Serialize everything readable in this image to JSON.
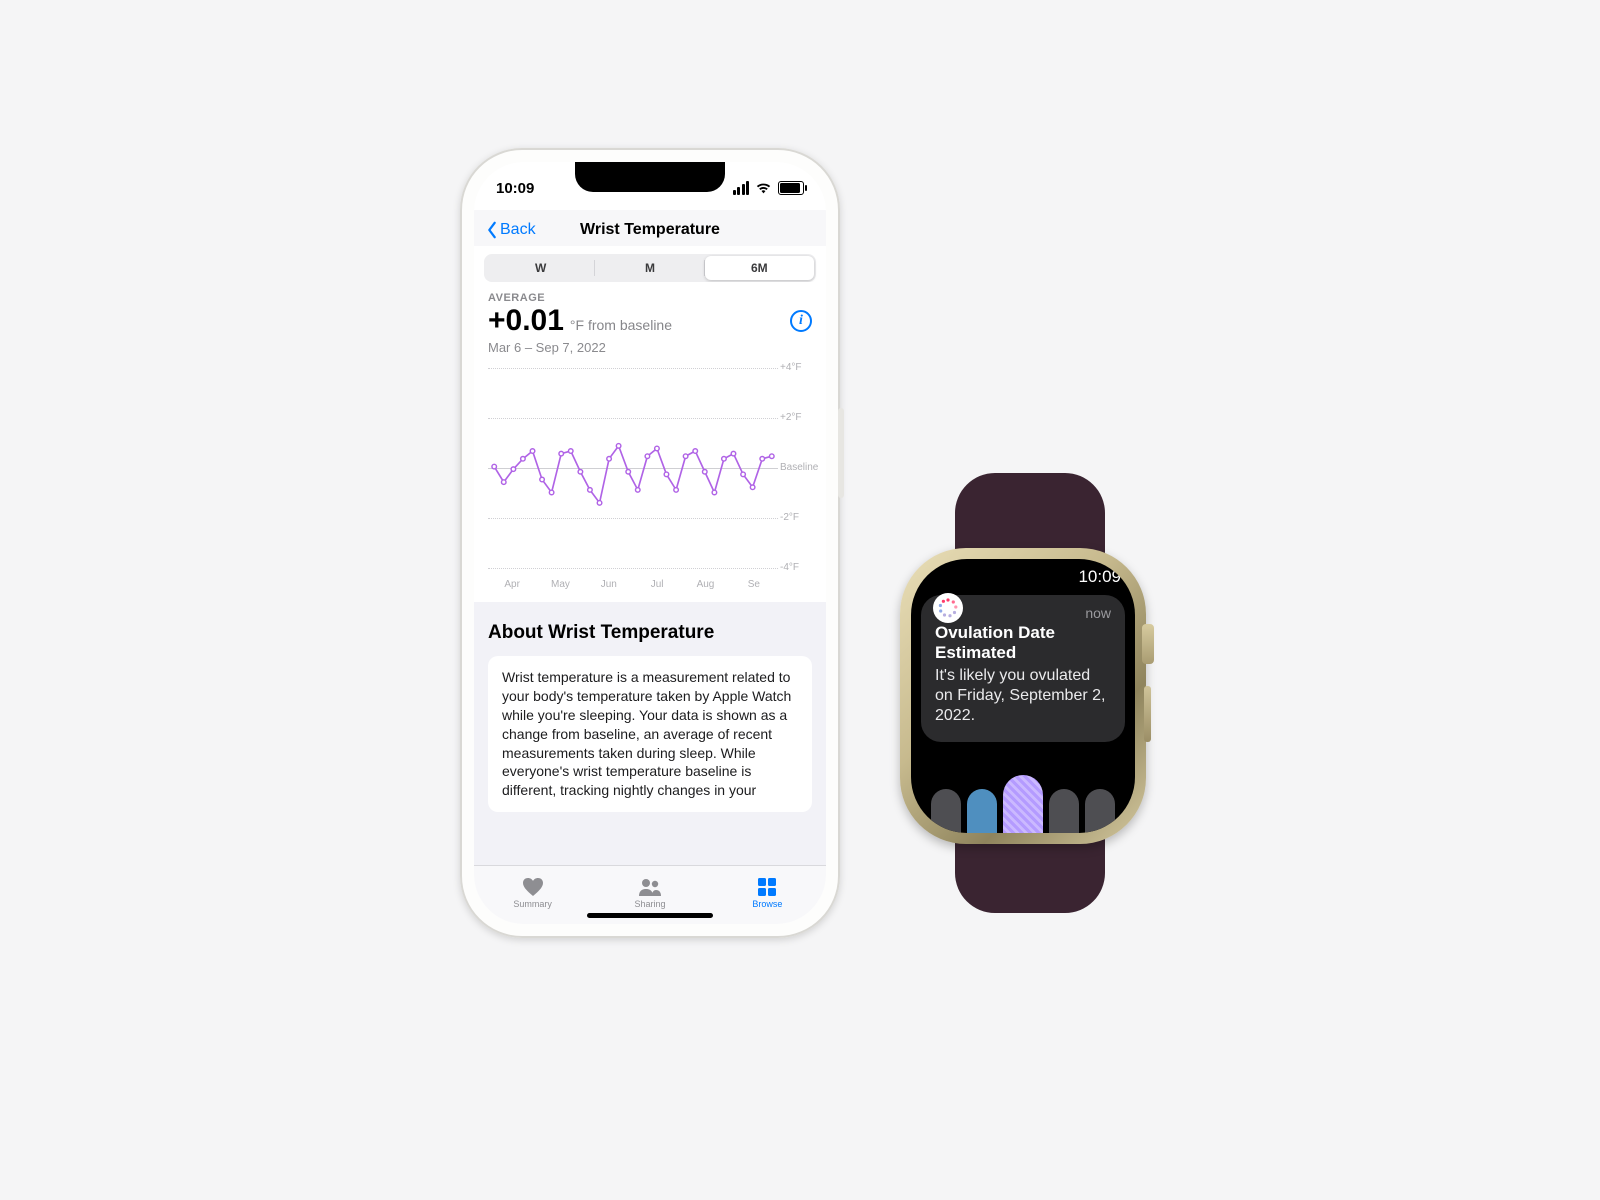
{
  "phone": {
    "status": {
      "time": "10:09"
    },
    "nav": {
      "back": "Back",
      "title": "Wrist Temperature"
    },
    "segments": {
      "w": "W",
      "m": "M",
      "six_m": "6M"
    },
    "summary": {
      "label": "AVERAGE",
      "value": "+0.01",
      "unit": "°F from baseline",
      "range": "Mar 6 – Sep 7, 2022"
    },
    "chart": {
      "ylabels": {
        "p4": "+4°F",
        "p2": "+2°F",
        "base": "Baseline",
        "m2": "-2°F",
        "m4": "-4°F"
      },
      "months": [
        "Apr",
        "May",
        "Jun",
        "Jul",
        "Aug",
        "Se"
      ]
    },
    "about": {
      "heading": "About Wrist Temperature",
      "body": "Wrist temperature is a measurement related to your body's temperature taken by Apple Watch while you're sleeping. Your data is shown as a change from baseline, an average of recent measurements taken during sleep. While everyone's wrist temperature baseline is different, tracking nightly changes in your"
    },
    "tabs": {
      "summary": "Summary",
      "sharing": "Sharing",
      "browse": "Browse"
    }
  },
  "watch": {
    "status": {
      "time": "10:09"
    },
    "notif": {
      "now": "now",
      "title": "Ovulation Date Estimated",
      "body": "It's likely you ovulated on Friday, September 2, 2022."
    }
  },
  "chart_data": {
    "type": "line",
    "title": "Wrist Temperature",
    "xlabel": "",
    "ylabel": "°F from baseline",
    "ylim": [
      -4,
      4
    ],
    "x": [
      0,
      1,
      2,
      3,
      4,
      5,
      6,
      7,
      8,
      9,
      10,
      11,
      12,
      13,
      14,
      15,
      16,
      17,
      18,
      19,
      20,
      21,
      22,
      23,
      24,
      25,
      26,
      27,
      28,
      29
    ],
    "values": [
      0.2,
      -0.4,
      0.1,
      0.5,
      0.8,
      -0.3,
      -0.8,
      0.7,
      0.8,
      0.0,
      -0.7,
      -1.2,
      0.5,
      1.0,
      0.0,
      -0.7,
      0.6,
      0.9,
      -0.1,
      -0.7,
      0.6,
      0.8,
      0.0,
      -0.8,
      0.5,
      0.7,
      -0.1,
      -0.6,
      0.5,
      0.6
    ],
    "months_axis": [
      "Apr",
      "May",
      "Jun",
      "Jul",
      "Aug",
      "Sep"
    ]
  }
}
